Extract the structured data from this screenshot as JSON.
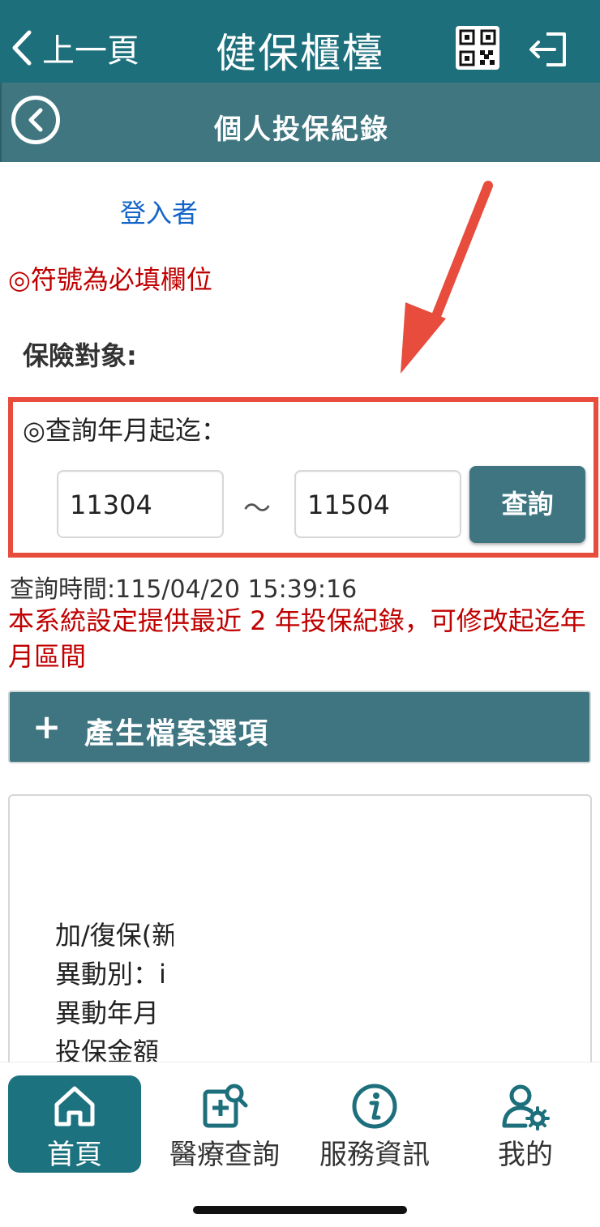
{
  "topbar": {
    "back_label": "上一頁",
    "title": "健保櫃檯",
    "qr_icon": "qr-code-icon",
    "logout_icon": "logout-icon"
  },
  "subbar": {
    "title": "個人投保紀錄",
    "back_icon": "circle-back-icon"
  },
  "form": {
    "login_user_label": "登入者",
    "required_note": "◎符號為必填欄位",
    "insured_label": "保險對象:",
    "range_label": "◎查詢年月起迄：",
    "start_value": "11304",
    "end_value": "11504",
    "separator": "～",
    "query_button": "查詢"
  },
  "info": {
    "query_time": "查詢時間:115/04/20 15:39:16",
    "notice": "本系統設定提供最近 2 年投保紀錄，可修改起迄年月區間"
  },
  "generate": {
    "plus": "+",
    "label": "產生檔案選項"
  },
  "record": {
    "lines": [
      "加/復保(新",
      "異動別：i",
      "異動年月",
      "投保金額"
    ]
  },
  "bottom_nav": {
    "items": [
      {
        "label": "首頁",
        "icon": "home-icon",
        "active": true
      },
      {
        "label": "醫療查詢",
        "icon": "medical-search-icon",
        "active": false
      },
      {
        "label": "服務資訊",
        "icon": "info-icon",
        "active": false
      },
      {
        "label": "我的",
        "icon": "user-settings-icon",
        "active": false
      }
    ]
  },
  "colors": {
    "topbar": "#1d6f7c",
    "subbar": "#3f7680",
    "button": "#3e7581",
    "alert_red": "#c00000",
    "highlight_red": "#e74c3c",
    "link_blue": "#1565c8"
  }
}
